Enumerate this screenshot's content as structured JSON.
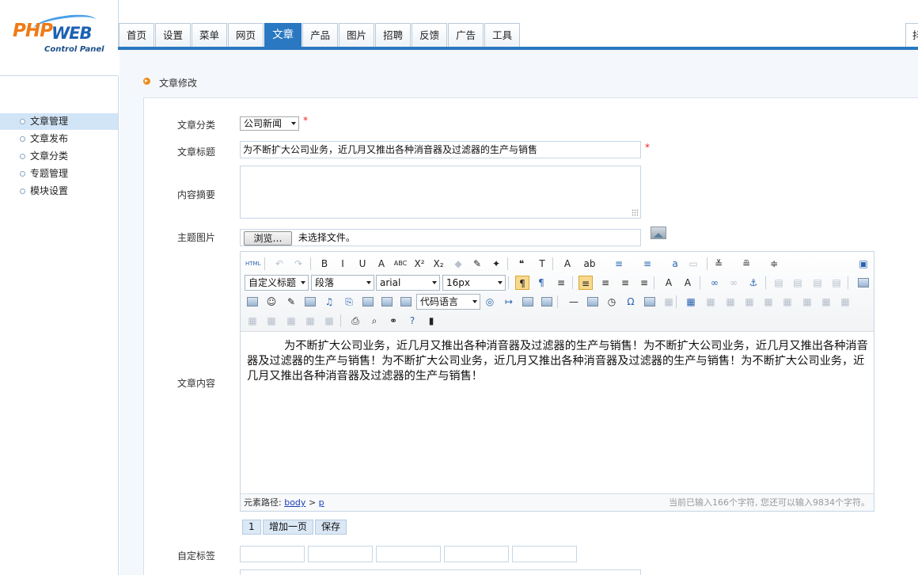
{
  "logo": {
    "php": "PHP",
    "web": "WEB",
    "subtitle": "Control Panel"
  },
  "nav": {
    "tabs": [
      "首页",
      "设置",
      "菜单",
      "网页",
      "文章",
      "产品",
      "图片",
      "招聘",
      "反馈",
      "广告",
      "工具"
    ],
    "active_tab": "文章",
    "extra": "抖"
  },
  "sidebar": {
    "items": [
      "文章管理",
      "文章发布",
      "文章分类",
      "专题管理",
      "模块设置"
    ],
    "active": "文章管理"
  },
  "breadcrumb": "文章修改",
  "form": {
    "category": {
      "label": "文章分类",
      "value": "公司新闻",
      "required": "*"
    },
    "title": {
      "label": "文章标题",
      "value": "为不断扩大公司业务，近几月又推出各种消音器及过滤器的生产与销售",
      "required": "*"
    },
    "summary": {
      "label": "内容摘要",
      "value": ""
    },
    "image": {
      "label": "主题图片",
      "browse_label": "浏览…",
      "file_status": "未选择文件。"
    },
    "content_label": "文章内容",
    "custom_tags_label": "自定标签"
  },
  "editor": {
    "selects": {
      "heading": "自定义标题",
      "paragraph": "段落",
      "font": "arial",
      "size": "16px",
      "code": "代码语言"
    },
    "content": "为不断扩大公司业务，近几月又推出各种消音器及过滤器的生产与销售！为不断扩大公司业务，近几月又推出各种消音器及过滤器的生产与销售！为不断扩大公司业务，近几月又推出各种消音器及过滤器的生产与销售！为不断扩大公司业务，近几月又推出各种消音器及过滤器的生产与销售！",
    "path_label": "元素路径:",
    "path_body": "body",
    "path_sep": ">",
    "path_p": "p",
    "char_count": "当前已输入166个字符, 您还可以输入9834个字符。",
    "toolbar_icons": [
      "html-icon",
      "undo-icon",
      "redo-icon",
      "bold-icon",
      "italic-icon",
      "underline-icon",
      "border-icon",
      "strikethrough-icon",
      "superscript-icon",
      "subscript-icon",
      "eraser-icon",
      "format-brush-icon",
      "magic-wand-icon",
      "quote-icon",
      "paste-text-icon",
      "font-color-icon",
      "highlight-icon",
      "ordered-list-icon",
      "unordered-list-icon",
      "select-all-icon",
      "clear-doc-icon",
      "row-spacing-top-icon",
      "row-spacing-bottom-icon",
      "line-height-icon",
      "fullscreen-icon"
    ]
  },
  "pagination": {
    "page": "1",
    "add_page": "增加一页",
    "save": "保存"
  }
}
